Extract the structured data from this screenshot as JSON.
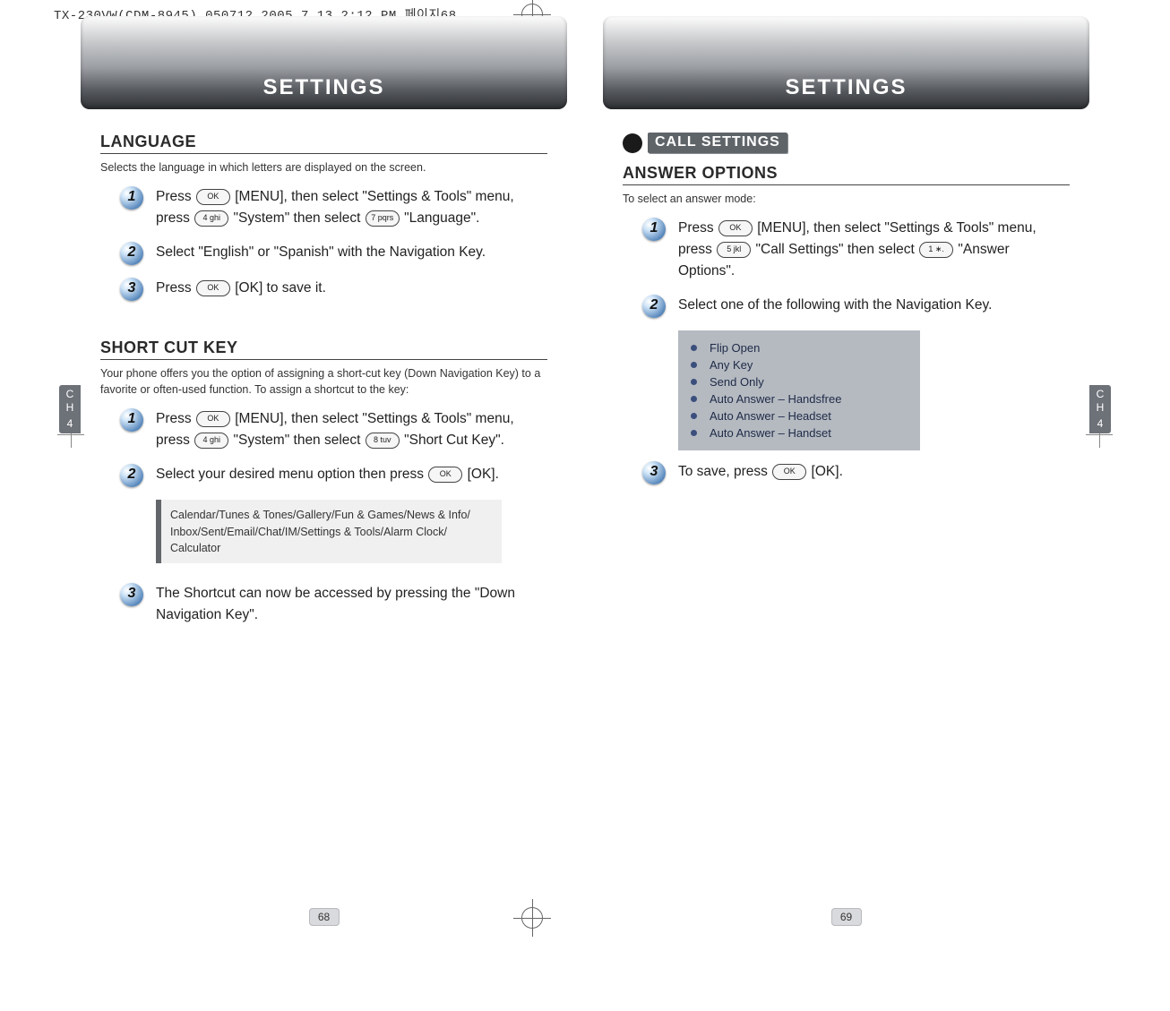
{
  "print_header": "TX-230VW(CDM-8945)_050712  2005.7.13 2:12 PM  페이지68",
  "left": {
    "banner_title": "SETTINGS",
    "ch_label_top": "C\nH",
    "ch_label_bot": "4",
    "page_number": "68",
    "sec_language": {
      "title": "LANGUAGE",
      "intro": "Selects the language in which letters are displayed on the screen.",
      "steps": [
        {
          "n": "1",
          "text_a": "Press ",
          "key_a": "OK",
          "text_b": " [MENU], then select \"Settings & Tools\" menu, press ",
          "key_b": "4 ghi",
          "text_c": " \"System\" then select ",
          "key_c": "7 pqrs",
          "text_d": " \"Language\"."
        },
        {
          "n": "2",
          "text_a": "Select \"English\" or \"Spanish\" with the Navigation Key."
        },
        {
          "n": "3",
          "text_a": "Press ",
          "key_a": "OK",
          "text_b": " [OK] to save it."
        }
      ]
    },
    "sec_shortcut": {
      "title": "SHORT CUT KEY",
      "intro": "Your phone offers you the option of assigning a short-cut key (Down Navigation Key) to a favorite or often-used function. To assign a shortcut to the key:",
      "steps": [
        {
          "n": "1",
          "text_a": "Press ",
          "key_a": "OK",
          "text_b": " [MENU], then select \"Settings & Tools\" menu, press ",
          "key_b": "4 ghi",
          "text_c": " \"System\" then select ",
          "key_c": "8 tuv",
          "text_d": " \"Short Cut Key\"."
        },
        {
          "n": "2",
          "text_a": "Select your desired menu option then press ",
          "key_a": "OK",
          "text_b": " [OK]."
        },
        {
          "n": "3",
          "text_a": "The Shortcut can now be accessed by pressing the \"Down Navigation Key\"."
        }
      ],
      "note": "Calendar/Tunes & Tones/Gallery/Fun & Games/News & Info/ Inbox/Sent/Email/Chat/IM/Settings & Tools/Alarm Clock/ Calculator"
    }
  },
  "right": {
    "banner_title": "SETTINGS",
    "ch_label_top": "C\nH",
    "ch_label_bot": "4",
    "page_number": "69",
    "pill": "CALL SETTINGS",
    "sec_answer": {
      "title": "ANSWER OPTIONS",
      "intro": "To select an answer mode:",
      "steps": [
        {
          "n": "1",
          "text_a": "Press ",
          "key_a": "OK",
          "text_b": " [MENU], then select \"Settings & Tools\" menu, press ",
          "key_b": "5 jkl",
          "text_c": " \"Call Settings\" then select ",
          "key_c": "1 ∗.",
          "text_d": " \"Answer Options\"."
        },
        {
          "n": "2",
          "text_a": "Select one of the following with the Navigation Key."
        },
        {
          "n": "3",
          "text_a": "To save, press ",
          "key_a": "OK",
          "text_b": " [OK]."
        }
      ],
      "options": [
        "Flip Open",
        "Any Key",
        "Send Only",
        "Auto Answer – Handsfree",
        "Auto Answer – Headset",
        "Auto Answer – Handset"
      ]
    }
  }
}
